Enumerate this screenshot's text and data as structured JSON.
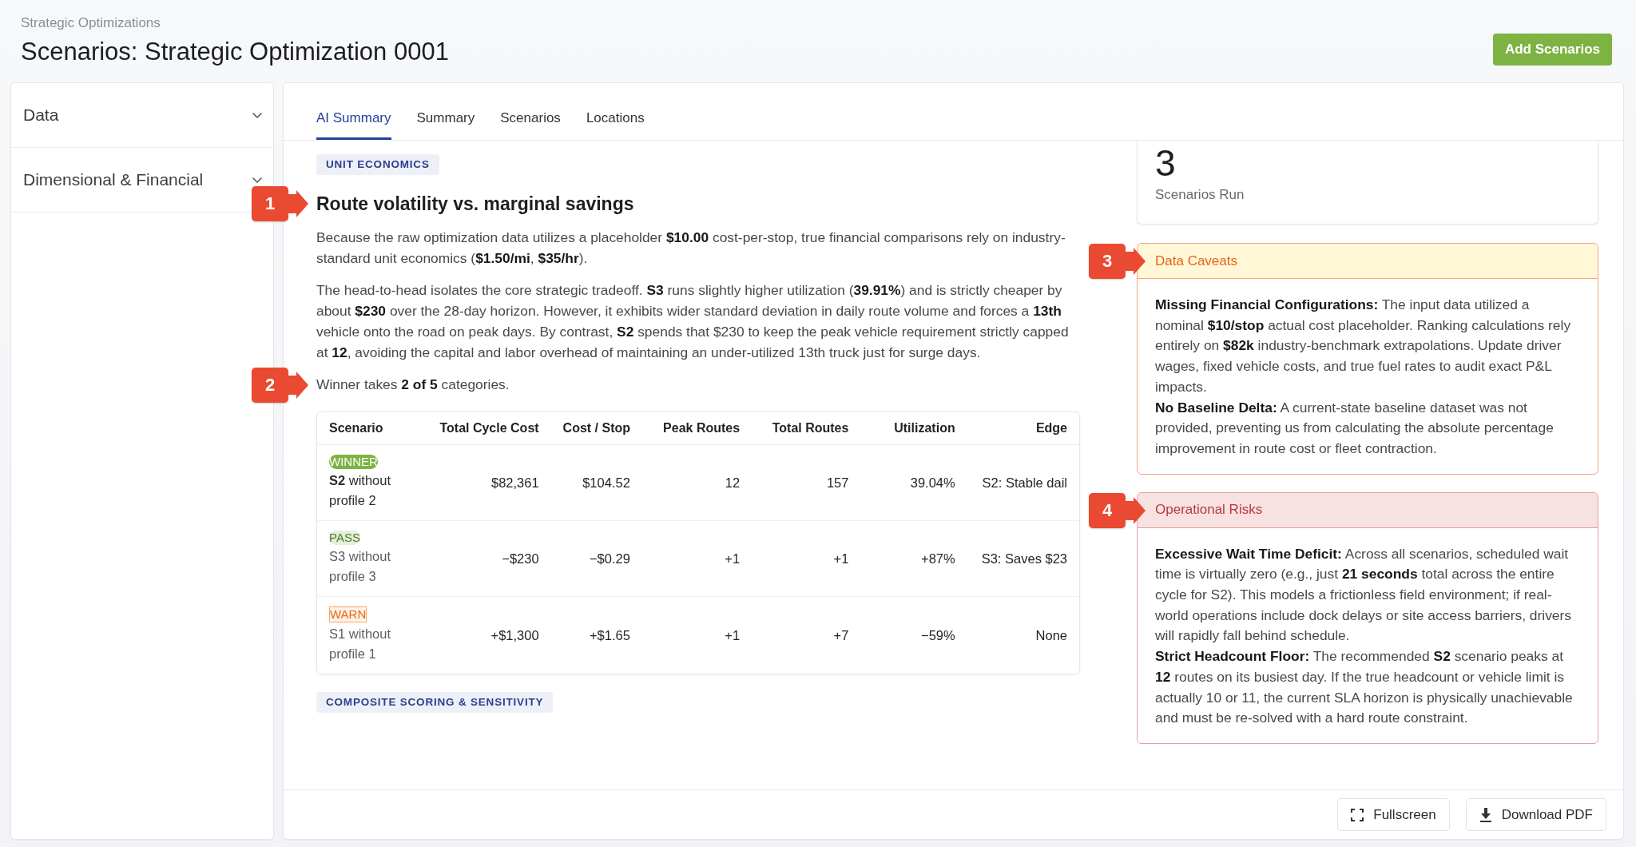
{
  "header": {
    "breadcrumb": "Strategic Optimizations",
    "title": "Scenarios: Strategic Optimization 0001",
    "action": "Add Scenarios"
  },
  "sidebar": {
    "items": [
      {
        "label": "Data",
        "expanded": false
      },
      {
        "label": "Dimensional & Financial",
        "expanded": false
      }
    ]
  },
  "tabs": [
    {
      "label": "AI Summary",
      "selected": true
    },
    {
      "label": "Summary",
      "selected": false
    },
    {
      "label": "Scenarios",
      "selected": false
    },
    {
      "label": "Locations",
      "selected": false
    }
  ],
  "summary": {
    "section_tag": "UNIT ECONOMICS",
    "heading": "Route volatility vs. marginal savings",
    "heading_callout": "1",
    "paragraphs": [
      "Because the raw optimization data utilizes a placeholder **$10.00** cost-per-stop, true financial comparisons rely on industry-standard unit economics (**$1.50/mi**, **$35/hr**).",
      "The head-to-head isolates the core strategic tradeoff. **S3** runs slightly higher utilization (**39.91%**) and is strictly cheaper by about **$230** over the 28-day horizon. However, it exhibits wider standard deviation in daily route volume and forces a **13th** vehicle onto the road on peak days. By contrast, **S2** spends that $230 to keep the peak vehicle requirement strictly capped at **12**, avoiding the capital and labor overhead of maintaining an under-utilized 13th truck just for surge days."
    ],
    "winner_note": "Winner takes **2 of 5** categories.",
    "winner_note_callout": "2",
    "table": {
      "columns": [
        "Scenario",
        "Total Cycle Cost",
        "Cost / Stop",
        "Peak Routes",
        "Total Routes",
        "Utilization",
        "Edge"
      ],
      "rows": [
        {
          "badge": {
            "kind": "winner",
            "label": "WINNER"
          },
          "cells": [
            "**S2** without profile 2",
            "$82,361",
            "$104.52",
            "12",
            "157",
            "39.04%",
            "S2: Stable dail"
          ]
        },
        {
          "badge": {
            "kind": "pass",
            "label": "PASS"
          },
          "cells": [
            "S3 without profile 3",
            "−$230",
            "−$0.29",
            "+1",
            "+1",
            "+87%",
            "S3: Saves $23"
          ]
        },
        {
          "badge": {
            "kind": "warn",
            "label": "WARN"
          },
          "cells": [
            "S1 without profile 1",
            "+$1,300",
            "+$1.65",
            "+1",
            "+7",
            "−59%",
            "None"
          ]
        }
      ]
    },
    "next_section_tag": "COMPOSITE SCORING & SENSITIVITY"
  },
  "stat_card": {
    "value": "3",
    "label": "Scenarios Run"
  },
  "notices": [
    {
      "kind": "caveat",
      "title": "Data Caveats",
      "callout": "3",
      "paragraphs": [
        "**Missing Financial Configurations:** The input data utilized a nominal **$10/stop** actual cost placeholder. Ranking calculations rely entirely on **$82k** industry-benchmark extrapolations. Update driver wages, fixed vehicle costs, and true fuel rates to audit exact P&L impacts.",
        "**No Baseline Delta:** A current-state baseline dataset was not provided, preventing us from calculating the absolute percentage improvement in route cost or fleet contraction."
      ]
    },
    {
      "kind": "risk",
      "title": "Operational Risks",
      "callout": "4",
      "paragraphs": [
        "**Excessive Wait Time Deficit:** Across all scenarios, scheduled wait time is virtually zero (e.g., just **21 seconds** total across the entire cycle for S2). This models a frictionless field environment; if real-world operations include dock delays or site access barriers, drivers will rapidly fall behind schedule.",
        "**Strict Headcount Floor:** The recommended **S2** scenario peaks at **12** routes on its busiest day. If the true headcount or vehicle limit is actually 10 or 11, the current SLA horizon is physically unachievable and must be re-solved with a hard route constraint."
      ]
    }
  ],
  "footer": {
    "buttons": [
      {
        "kind": "fullscreen",
        "label": "Fullscreen"
      },
      {
        "kind": "download",
        "label": "Download PDF"
      }
    ]
  }
}
